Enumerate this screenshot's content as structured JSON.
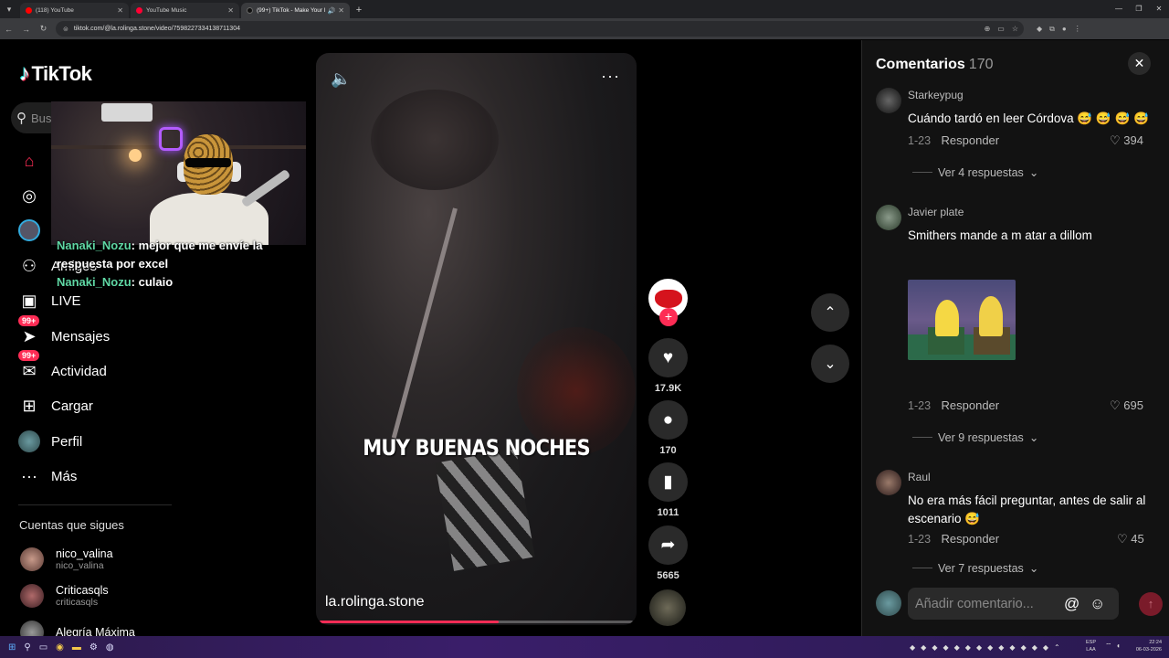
{
  "browser": {
    "tabs": [
      {
        "title": "(118) YouTube",
        "color": "#ff0000",
        "active": false
      },
      {
        "title": "YouTube Music",
        "color": "#ff0033",
        "active": false
      },
      {
        "title": "(99+) TikTok - Make Your Day",
        "color": "#111111",
        "active": true
      }
    ],
    "url": "tiktok.com/@la.rolinga.stone/video/7598227334138711304"
  },
  "sidebar": {
    "logo": "TikTok",
    "search_placeholder": "Bus",
    "nav": [
      {
        "label": "",
        "icon": "home-icon"
      },
      {
        "label": "",
        "icon": "compass-icon"
      },
      {
        "label": "",
        "icon": "following-avatar-icon"
      },
      {
        "label": "Amigos",
        "icon": "friends-icon"
      },
      {
        "label": "LIVE",
        "icon": "live-icon"
      },
      {
        "label": "Mensajes",
        "icon": "messages-icon",
        "badge": "99+"
      },
      {
        "label": "Actividad",
        "icon": "activity-icon",
        "badge": "99+"
      },
      {
        "label": "Cargar",
        "icon": "upload-icon"
      },
      {
        "label": "Perfil",
        "icon": "profile-icon"
      },
      {
        "label": "Más",
        "icon": "more-icon"
      }
    ],
    "following_title": "Cuentas que sigues",
    "accounts": [
      {
        "name": "nico_valina",
        "handle": "nico_valina"
      },
      {
        "name": "Criticasqls",
        "handle": "criticasqls"
      },
      {
        "name": "Alegría Máxima",
        "handle": ""
      }
    ]
  },
  "stream_chat": [
    {
      "user": "Nanaki_Nozu",
      "text": "mejor que me envíe la respuesta por excel"
    },
    {
      "user": "Nanaki_Nozu",
      "text": "culaio"
    }
  ],
  "video": {
    "caption": "MUY BUENAS NOCHES",
    "author": "la.rolinga.stone",
    "progress": 0.57
  },
  "actions": {
    "likes": "17.9K",
    "comments": "170",
    "saves": "1011",
    "shares": "5665"
  },
  "comments_panel": {
    "title": "Comentarios",
    "count": "170",
    "comments": [
      {
        "user": "Starkeypug",
        "text": "Cuándo tardó en leer Córdova 😅 😅 😅 😅",
        "date": "1-23",
        "reply": "Responder",
        "likes": "394",
        "replies": "Ver 4 respuestas"
      },
      {
        "user": "Javier plate",
        "text": "Smithers mande a m atar a dillom",
        "date": "1-23",
        "reply": "Responder",
        "likes": "695",
        "replies": "Ver 9 respuestas"
      },
      {
        "user": "Raul",
        "text": "No era más fácil preguntar, antes de salir al escenario 😅",
        "date": "1-23",
        "reply": "Responder",
        "likes": "45",
        "replies": "Ver 7 respuestas"
      }
    ],
    "input_placeholder": "Añadir comentario..."
  },
  "taskbar": {
    "lang_line1": "ESP",
    "lang_line2": "LAA",
    "time": "22:24",
    "date": "06-03-2026"
  }
}
